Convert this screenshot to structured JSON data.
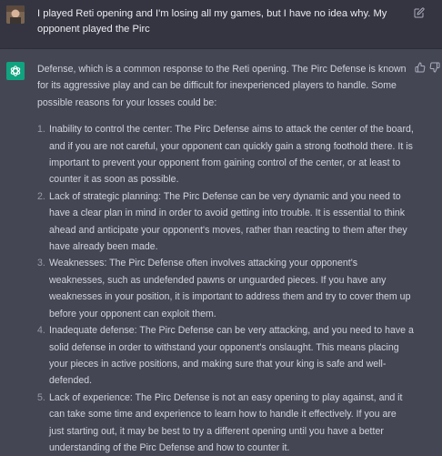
{
  "user_message": {
    "text": "I played Reti opening and I'm losing all my games, but I have no idea why. My opponent played the Pirc"
  },
  "assistant_message": {
    "intro": "Defense, which is a common response to the Reti opening. The Pirc Defense is known for its aggressive play and can be difficult for inexperienced players to handle. Some possible reasons for your losses could be:",
    "items": [
      {
        "number": "1.",
        "text": "Inability to control the center: The Pirc Defense aims to attack the center of the board, and if you are not careful, your opponent can quickly gain a strong foothold there. It is important to prevent your opponent from gaining control of the center, or at least to counter it as soon as possible."
      },
      {
        "number": "2.",
        "text": "Lack of strategic planning: The Pirc Defense can be very dynamic and you need to have a clear plan in mind in order to avoid getting into trouble. It is essential to think ahead and anticipate your opponent's moves, rather than reacting to them after they have already been made."
      },
      {
        "number": "3.",
        "text": "Weaknesses: The Pirc Defense often involves attacking your opponent's weaknesses, such as undefended pawns or unguarded pieces. If you have any weaknesses in your position, it is important to address them and try to cover them up before your opponent can exploit them."
      },
      {
        "number": "4.",
        "text": "Inadequate defense: The Pirc Defense can be very attacking, and you need to have a solid defense in order to withstand your opponent's onslaught. This means placing your pieces in active positions, and making sure that your king is safe and well-defended."
      },
      {
        "number": "5.",
        "text": "Lack of experience: The Pirc Defense is not an easy opening to play against, and it can take some time and experience to learn how to handle it effectively. If you are just starting out, it may be best to try a different opening until you have a better understanding of the Pirc Defense and how to counter it."
      }
    ]
  },
  "icons": {
    "edit": "edit-icon",
    "thumbs_up": "thumbs-up-icon",
    "thumbs_down": "thumbs-down-icon",
    "assistant_logo": "openai-logo-icon",
    "user_avatar": "user-avatar-photo"
  },
  "colors": {
    "user_bg": "#343541",
    "assistant_bg": "#444654",
    "logo_bg": "#10a37f",
    "text": "#d1d5db"
  }
}
